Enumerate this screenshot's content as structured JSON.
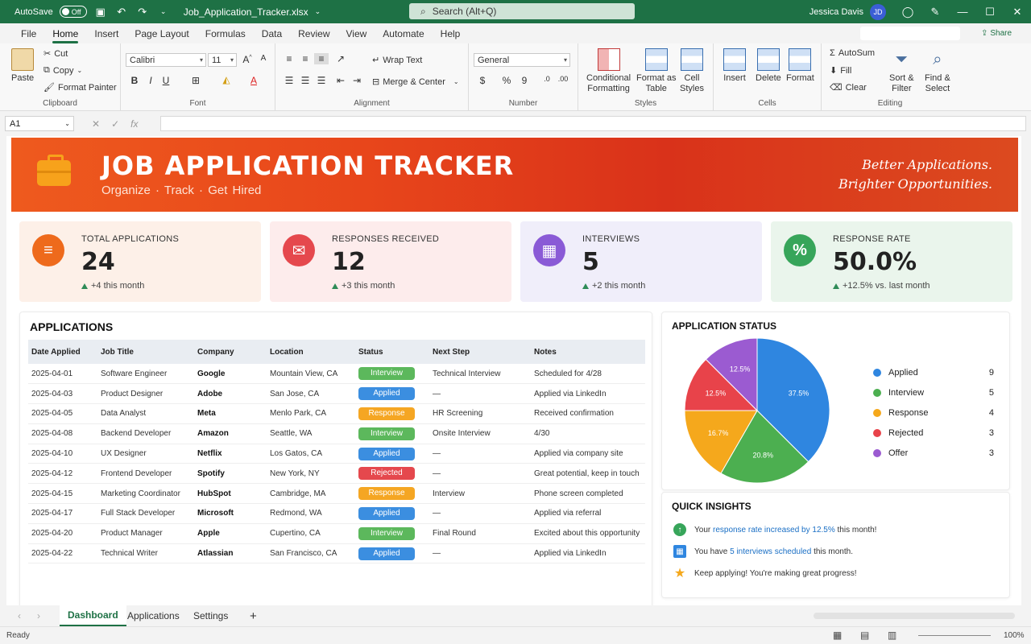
{
  "titlebar": {
    "autosave_label": "AutoSave",
    "autosave_state": "Off",
    "filename": "Job_Application_Tracker.xlsx",
    "search_placeholder": "Search (Alt+Q)",
    "user_name": "Jessica Davis",
    "user_initials": "JD"
  },
  "menu": {
    "tabs": [
      "File",
      "Home",
      "Insert",
      "Page Layout",
      "Formulas",
      "Data",
      "Review",
      "View",
      "Automate",
      "Help"
    ],
    "active": "Home",
    "share_label": "Share"
  },
  "ribbon": {
    "clipboard": {
      "label": "Clipboard",
      "paste": "Paste",
      "cut": "Cut",
      "copy": "Copy",
      "format_painter": "Format Painter"
    },
    "font": {
      "label": "Font",
      "font_name": "Calibri",
      "font_size": "11"
    },
    "alignment": {
      "label": "Alignment",
      "wrap": "Wrap Text",
      "merge": "Merge & Center"
    },
    "number": {
      "label": "Number",
      "format": "General"
    },
    "styles": {
      "label": "Styles",
      "conditional": "Conditional",
      "conditional2": "Formatting",
      "format_table": "Format as",
      "format_table2": "Table",
      "cell_styles": "Cell",
      "cell_styles2": "Styles"
    },
    "cells": {
      "label": "Cells",
      "insert": "Insert",
      "delete": "Delete",
      "format": "Format"
    },
    "editing": {
      "label": "Editing",
      "autosum": "AutoSum",
      "fill": "Fill",
      "clear": "Clear",
      "sort": "Sort &",
      "sort2": "Filter",
      "find": "Find &",
      "find2": "Select"
    }
  },
  "formula_bar": {
    "cell_ref": "A1"
  },
  "banner": {
    "title": "JOB APPLICATION TRACKER",
    "subtitle": "Organize  ·  Track  ·  Get Hired",
    "tagline1": "Better Applications.",
    "tagline2": "Brighter Opportunities."
  },
  "kpis": [
    {
      "label": "TOTAL APPLICATIONS",
      "value": "24",
      "delta": "+4 this month",
      "icon_glyph": "≡",
      "icon_color": "#ee6a1c",
      "bg": "#fdf0e8"
    },
    {
      "label": "RESPONSES RECEIVED",
      "value": "12",
      "delta": "+3 this month",
      "icon_glyph": "✉",
      "icon_color": "#e5484d",
      "bg": "#fdecec"
    },
    {
      "label": "INTERVIEWS",
      "value": "5",
      "delta": "+2 this month",
      "icon_glyph": "▦",
      "icon_color": "#8a5ad6",
      "bg": "#f0eefa"
    },
    {
      "label": "RESPONSE RATE",
      "value": "50.0%",
      "delta": "+12.5% vs. last month",
      "icon_glyph": "%",
      "icon_color": "#37a55a",
      "bg": "#eaf5ec"
    }
  ],
  "applications": {
    "title": "APPLICATIONS",
    "columns": [
      "Date Applied",
      "Job Title",
      "Company",
      "Location",
      "Status",
      "Next Step",
      "Notes"
    ],
    "rows": [
      [
        "2025-04-01",
        "Software Engineer",
        "Google",
        "Mountain View, CA",
        "Interview",
        "Technical Interview",
        "Scheduled for 4/28"
      ],
      [
        "2025-04-03",
        "Product Designer",
        "Adobe",
        "San Jose, CA",
        "Applied",
        "—",
        "Applied via LinkedIn"
      ],
      [
        "2025-04-05",
        "Data Analyst",
        "Meta",
        "Menlo Park, CA",
        "Response",
        "HR Screening",
        "Received confirmation"
      ],
      [
        "2025-04-08",
        "Backend Developer",
        "Amazon",
        "Seattle, WA",
        "Interview",
        "Onsite Interview",
        "4/30"
      ],
      [
        "2025-04-10",
        "UX Designer",
        "Netflix",
        "Los Gatos, CA",
        "Applied",
        "—",
        "Applied via company site"
      ],
      [
        "2025-04-12",
        "Frontend Developer",
        "Spotify",
        "New York, NY",
        "Rejected",
        "—",
        "Great potential, keep in touch"
      ],
      [
        "2025-04-15",
        "Marketing Coordinator",
        "HubSpot",
        "Cambridge, MA",
        "Response",
        "Interview",
        "Phone screen completed"
      ],
      [
        "2025-04-17",
        "Full Stack Developer",
        "Microsoft",
        "Redmond, WA",
        "Applied",
        "—",
        "Applied via referral"
      ],
      [
        "2025-04-20",
        "Product Manager",
        "Apple",
        "Cupertino, CA",
        "Interview",
        "Final Round",
        "Excited about this opportunity"
      ],
      [
        "2025-04-22",
        "Technical Writer",
        "Atlassian",
        "San Francisco, CA",
        "Applied",
        "—",
        "Applied via LinkedIn"
      ]
    ]
  },
  "status_colors": {
    "Interview": "#5cb85c",
    "Applied": "#3b8ee0",
    "Response": "#f5a623",
    "Rejected": "#e5484d",
    "Offer": "#8a5ad6"
  },
  "chart_data": {
    "type": "pie",
    "title": "APPLICATION STATUS",
    "categories": [
      "Applied",
      "Interview",
      "Response",
      "Rejected",
      "Offer"
    ],
    "values": [
      9,
      5,
      4,
      3,
      3
    ],
    "data_labels": [
      "37.5%",
      "20.8%",
      "16.7%",
      "12.5%",
      "12.5%"
    ],
    "colors": [
      "#2f86e0",
      "#4caf50",
      "#f5a81c",
      "#e8434a",
      "#9b5bd1"
    ],
    "legend_position": "right"
  },
  "insights": {
    "title": "QUICK INSIGHTS",
    "items": [
      {
        "pre": "Your ",
        "highlight": "response rate increased by 12.5%",
        "post": " this month!"
      },
      {
        "pre": "You have ",
        "highlight": "5 interviews scheduled",
        "post": " this month."
      },
      {
        "pre": "Keep applying! You're making great progress!",
        "highlight": "",
        "post": ""
      }
    ]
  },
  "sheet_tabs": [
    "Dashboard",
    "Applications",
    "Settings"
  ],
  "status_bar": {
    "state": "Ready",
    "zoom": "100%"
  }
}
